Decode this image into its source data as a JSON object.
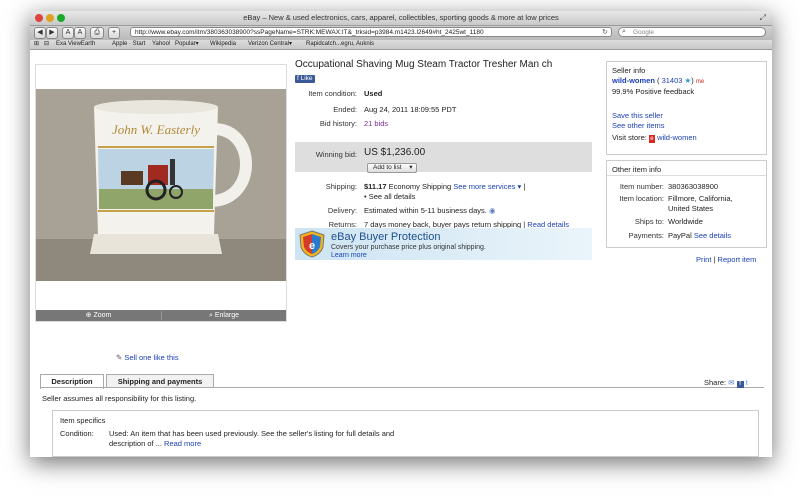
{
  "browser": {
    "title": "eBay – New & used electronics, cars, apparel, collectibles, sporting goods & more at low prices",
    "url": "http://www.ebay.com/itm/380363038900?ssPageName=STRK:MEWAX:IT&_trksid=p3984.m1423.l2649#ht_2425wt_1180",
    "search_placeholder": "Google",
    "bookmarks": [
      "Exa ViewEarth",
      "Apple · Start",
      "Yahoo!",
      "Popular▾",
      "Wikipedia",
      "Verizon Central▾",
      "Rapidcatch...egru, Auknis"
    ]
  },
  "item": {
    "title": "Occupational Shaving Mug Steam Tractor Tresher Man ch",
    "fb_like": "Like",
    "condition_label": "Item condition:",
    "condition": "Used",
    "ended_label": "Ended:",
    "ended": "Aug 24, 2011 18:09:55 PDT",
    "bid_history_label": "Bid history:",
    "bids": "21 bids",
    "winning_bid_label": "Winning bid:",
    "winning_bid": "US $1,236.00",
    "add_to_list": "Add to list",
    "shipping_label": "Shipping:",
    "shipping_cost": "$11.17",
    "shipping_type": "Economy Shipping",
    "see_more_services": "See more services",
    "see_all_details": "See all details",
    "delivery_label": "Delivery:",
    "delivery": "Estimated within 5-11 business days.",
    "returns_label": "Returns:",
    "returns": "7 days money back, buyer pays return shipping",
    "read_details": "Read details"
  },
  "photo": {
    "mug_text": "John W. Easterly",
    "zoom": "Zoom",
    "enlarge": "Enlarge"
  },
  "sell_one": "Sell one like this",
  "protection": {
    "title": "eBay Buyer Protection",
    "text": "Covers your purchase price plus original shipping.",
    "learn_more": "Learn more"
  },
  "seller": {
    "heading": "Seller info",
    "name": "wild-women",
    "score": "31403",
    "feedback": "99.9% Positive feedback",
    "save_seller": "Save this seller",
    "see_other": "See other items",
    "visit_store_label": "Visit store:",
    "store": "wild-women"
  },
  "other_info": {
    "heading": "Other item info",
    "number_label": "Item number:",
    "number": "380363038900",
    "location_label": "Item location:",
    "location_line1": "Fillmore, California,",
    "location_line2": "United States",
    "ships_label": "Ships to:",
    "ships": "Worldwide",
    "payments_label": "Payments:",
    "payments": "PayPal",
    "see_details": "See details"
  },
  "print": "Print",
  "report": "Report item",
  "tabs": [
    "Description",
    "Shipping and payments"
  ],
  "share_label": "Share:",
  "seller_note": "Seller assumes all responsibility for this listing.",
  "specifics": {
    "heading": "Item specifics",
    "condition_label": "Condition:",
    "condition_text_1": "Used: An item that has been used previously. See the seller's listing for full details and",
    "condition_text_2": "description of ...",
    "read_more": "Read more"
  },
  "colors": {
    "link": "#1a3fb5",
    "price": "#222222",
    "store_red": "#d8281f"
  }
}
